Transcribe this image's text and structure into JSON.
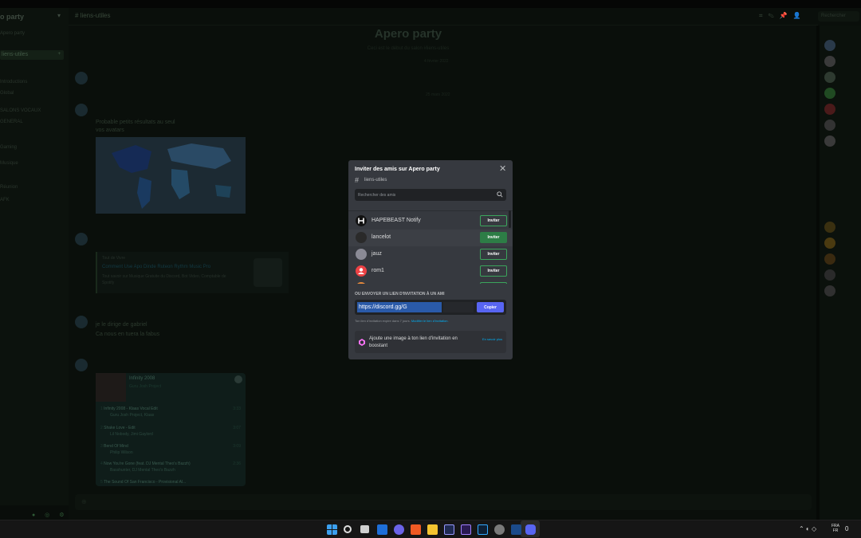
{
  "server": {
    "name": "o party"
  },
  "channel": {
    "name": "liens-utiles"
  },
  "sidebar_rows": [
    "Apero party",
    "liens-utiles",
    "Introductions",
    "Global",
    "SALONS VOCAUX",
    "GENERAL",
    "Gaming",
    "Musique",
    "Réunion",
    "AFK"
  ],
  "header": {
    "search_placeholder": "Rechercher"
  },
  "welcome": {
    "title": "Apero party",
    "subtitle": "Ceci est le début du salon #liens-utiles"
  },
  "messages": {
    "date1": "4 février 2022",
    "date2": "25 mars 2022",
    "text1": "Probable petits résultats au seul",
    "text2": "vos avatars",
    "text3": "je le dirige de gabriel",
    "text4": "Ca nous en tuera la fabus"
  },
  "embed": {
    "site": "Tout de Vivre",
    "title": "Comment Use Apo Dinde Ruteon Rythm Music Pro",
    "desc": "Tout savoir sur Musique Gratuite du Discord, Bot Video, Comptable de Spotify"
  },
  "spotify": {
    "title": "Infinity 2008",
    "artist": "Guru Josh Project",
    "tracks": [
      {
        "num": "1",
        "title": "Infinity 2008 - Klaas Vocal Edit",
        "artist": "Guru Josh Project, Klaas",
        "dur": "3:33"
      },
      {
        "num": "2",
        "title": "Shake Love - Edit",
        "artist": "Lil Nobody, Jimi Gaylord",
        "dur": "3:07"
      },
      {
        "num": "3",
        "title": "Bend Of Mind",
        "artist": "Philip Wilson",
        "dur": "3:09"
      },
      {
        "num": "4",
        "title": "Now You're Gone (feat. DJ Mental Theo's Bazzh)",
        "artist": "Basshunter, DJ Mental Theo's Bazzh",
        "dur": "2:36"
      },
      {
        "num": "5",
        "title": "The Sound Of San Francisco - Provisional Al...",
        "artist": "",
        "dur": "3:40"
      }
    ]
  },
  "modal": {
    "title": "Inviter des amis sur Apero party",
    "channel": "liens-utiles",
    "search_placeholder": "Rechercher des amis",
    "friends": [
      {
        "name": "HAPEBEAST Notify",
        "button": "Inviter",
        "avatar_color": "#111111"
      },
      {
        "name": "lancelot",
        "button": "Inviter",
        "avatar_color": "#2a2a2a"
      },
      {
        "name": "jauz",
        "button": "Inviter",
        "avatar_color": "#8a8a95"
      },
      {
        "name": "rom1",
        "button": "Inviter",
        "avatar_color": "#ed4245"
      }
    ],
    "or_label": "OU ENVOYER UN LIEN D'INVITATION À UN AMI",
    "invite_link": "https://discord.gg/G",
    "copy_label": "Copier",
    "expire_text": "Ton lien d'invitation expire dans 7 jours.",
    "expire_link": "Modifier le lien d'invitation.",
    "boost_text": "Ajoute une image à ton lien d'invitation en boostant",
    "boost_link": "En savoir plus"
  },
  "taskbar": {
    "lang1": "FRA",
    "lang2": "FR",
    "time": "0"
  },
  "colors": {
    "accent": "#5865f2",
    "invite_green": "#3ba55c",
    "invite_filled": "#2d7d46",
    "link": "#00aff4"
  }
}
